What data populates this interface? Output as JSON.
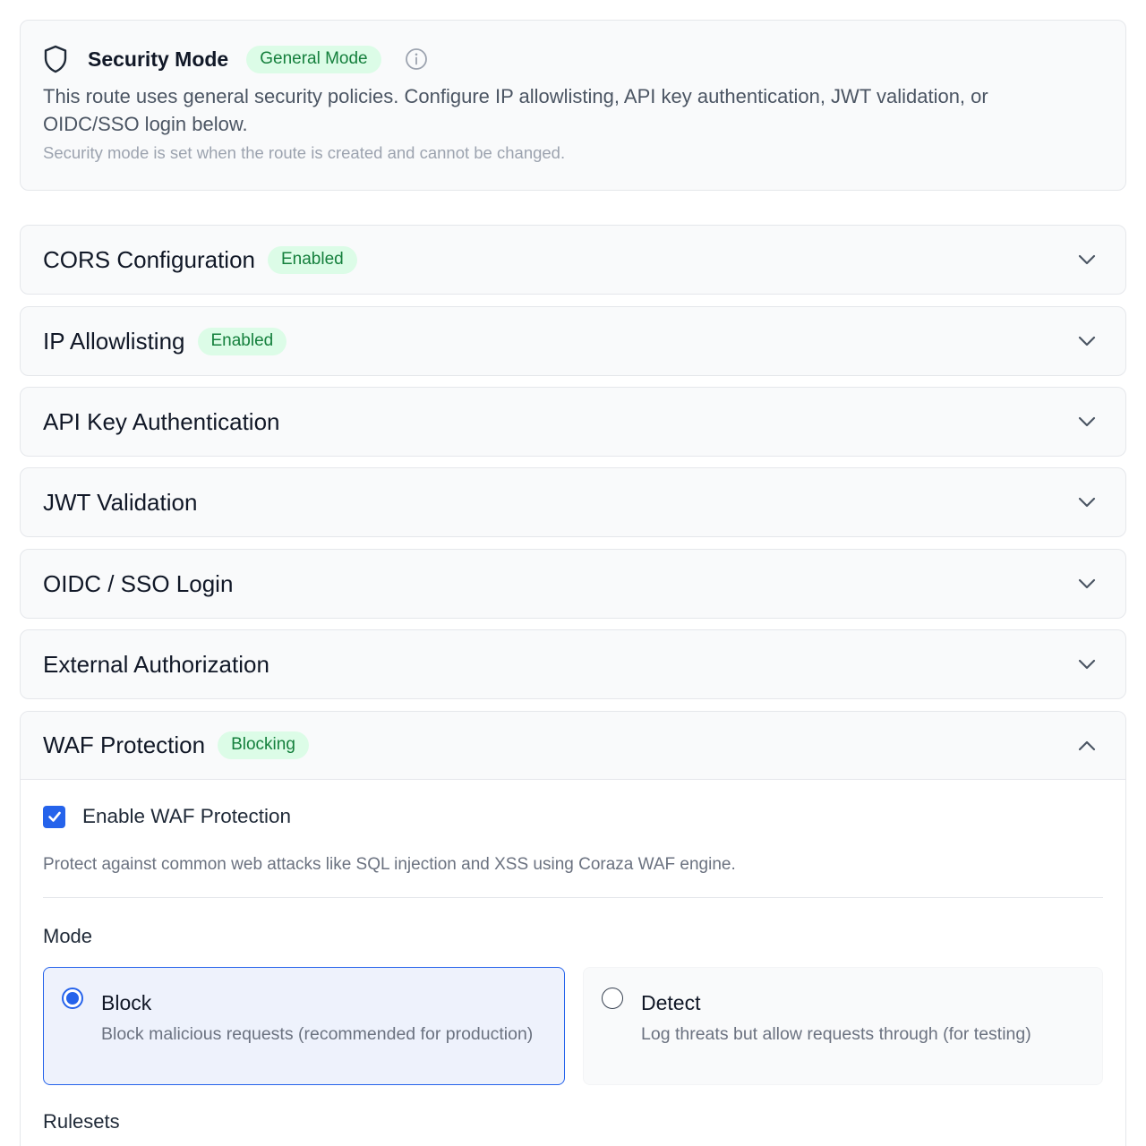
{
  "security_mode": {
    "title": "Security Mode",
    "badge": "General Mode",
    "description": "This route uses general security policies. Configure IP allowlisting, API key authentication, JWT validation, or OIDC/SSO login below.",
    "note": "Security mode is set when the route is created and cannot be changed.",
    "icon": "shield-icon",
    "info_icon": "info-icon"
  },
  "sections": [
    {
      "title": "CORS Configuration",
      "badge": "Enabled"
    },
    {
      "title": "IP Allowlisting",
      "badge": "Enabled"
    },
    {
      "title": "API Key Authentication",
      "badge": ""
    },
    {
      "title": "JWT Validation",
      "badge": ""
    },
    {
      "title": "OIDC / SSO Login",
      "badge": ""
    },
    {
      "title": "External Authorization",
      "badge": ""
    }
  ],
  "waf": {
    "title": "WAF Protection",
    "badge": "Blocking",
    "enable_label": "Enable WAF Protection",
    "enabled": true,
    "description": "Protect against common web attacks like SQL injection and XSS using Coraza WAF engine.",
    "mode_label": "Mode",
    "options": [
      {
        "title": "Block",
        "description": "Block malicious requests (recommended for production)",
        "selected": true
      },
      {
        "title": "Detect",
        "description": "Log threats but allow requests through (for testing)",
        "selected": false
      }
    ],
    "rulesets_label": "Rulesets"
  },
  "colors": {
    "accent": "#2563eb",
    "badge_bg": "#dcfce7",
    "badge_text": "#15803d"
  }
}
